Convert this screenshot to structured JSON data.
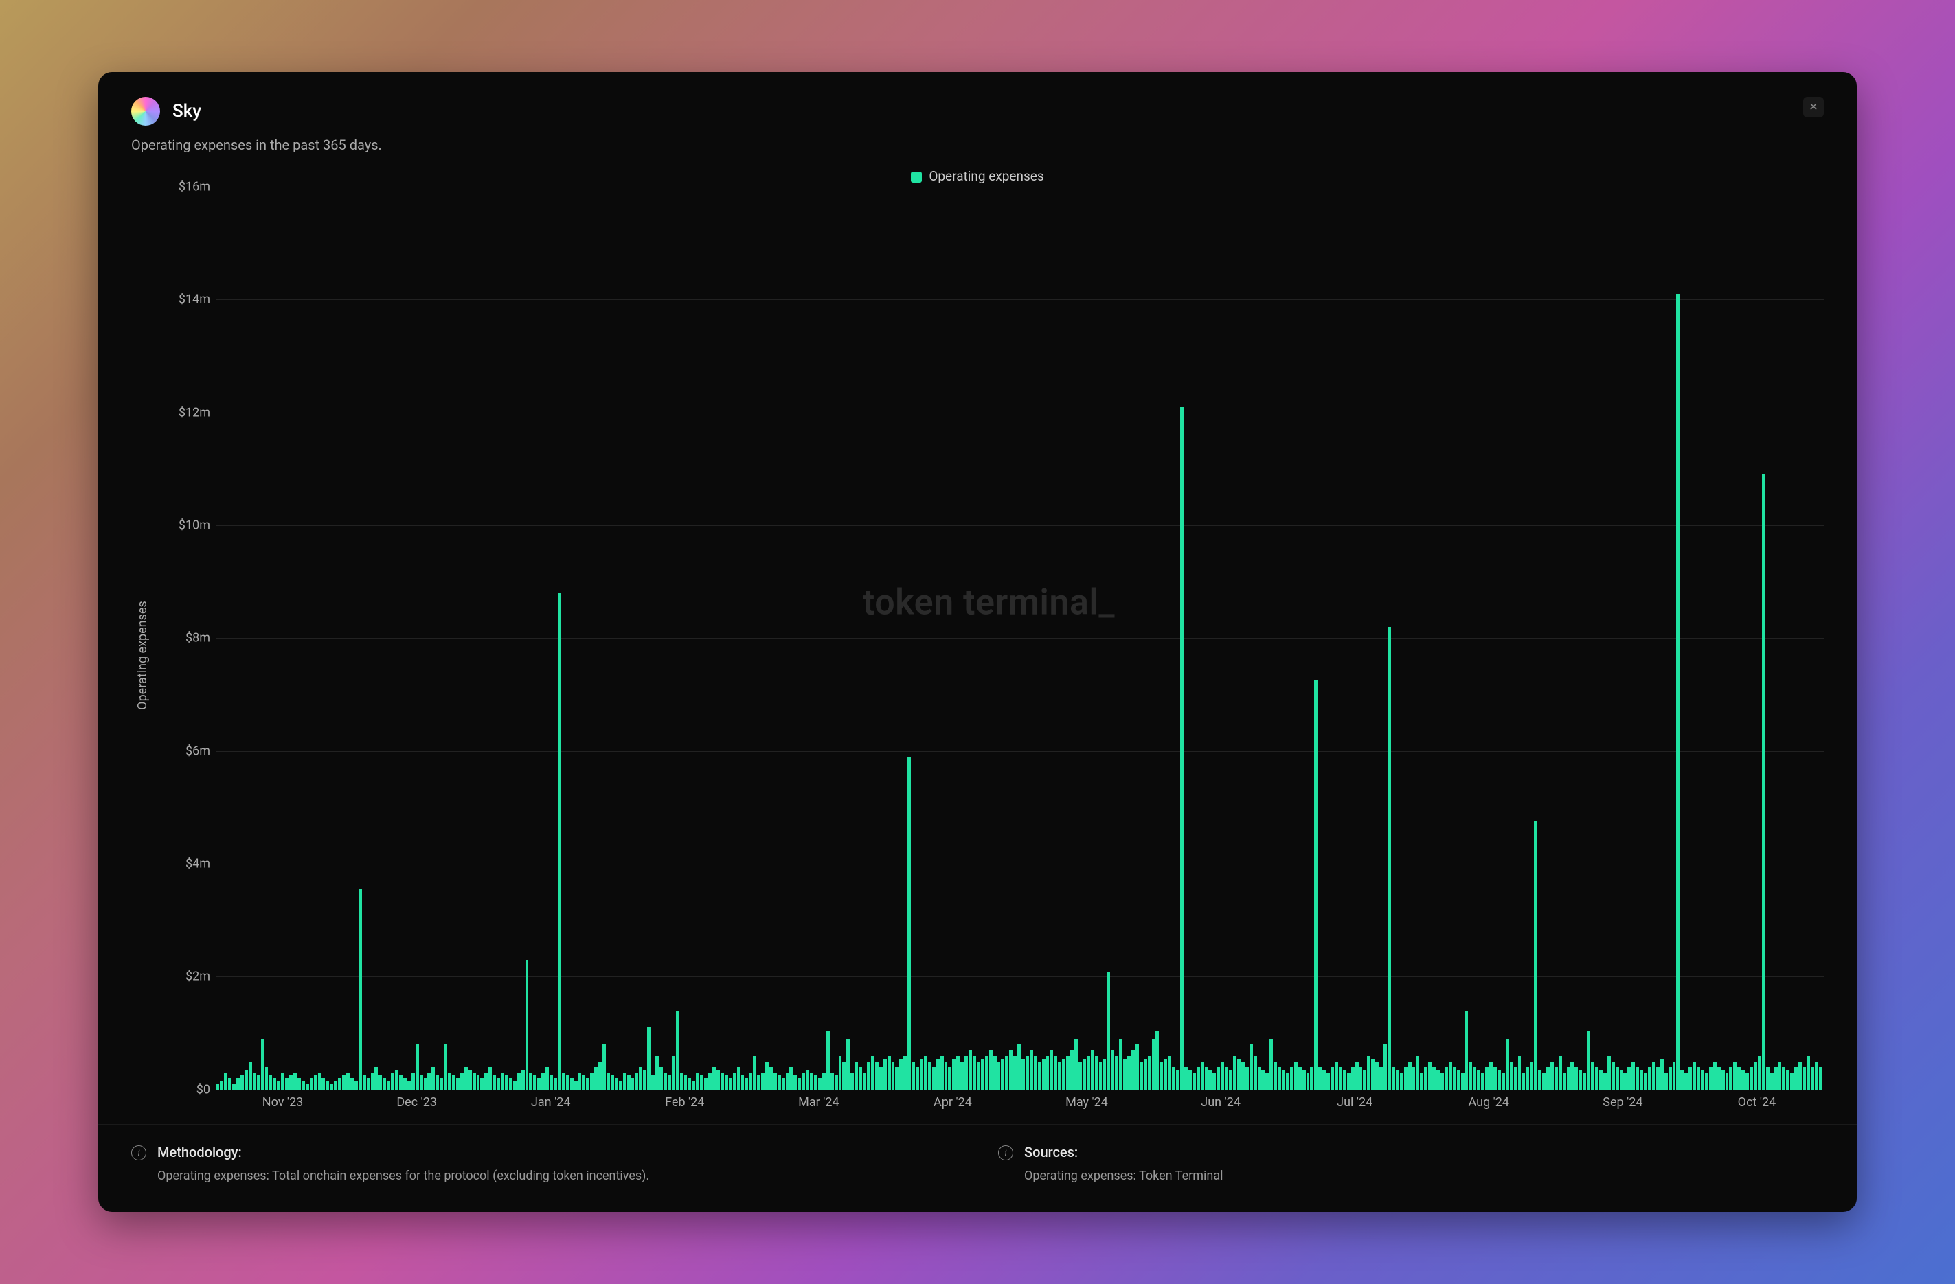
{
  "header": {
    "title": "Sky",
    "subtitle": "Operating expenses in the past 365 days."
  },
  "legend": {
    "label": "Operating expenses"
  },
  "watermark": "token terminal_",
  "footer": {
    "methodology_heading": "Methodology:",
    "methodology_text": "Operating expenses: Total onchain expenses for the protocol (excluding token incentives).",
    "sources_heading": "Sources:",
    "sources_text": "Operating expenses: Token Terminal"
  },
  "chart_data": {
    "type": "bar",
    "title": "Operating expenses in the past 365 days.",
    "ylabel": "Operating expenses",
    "xlabel": "",
    "ylim": [
      0,
      16000000
    ],
    "y_ticks": [
      "$0",
      "$2m",
      "$4m",
      "$6m",
      "$8m",
      "$10m",
      "$12m",
      "$14m",
      "$16m"
    ],
    "x_ticks": [
      "Nov '23",
      "Dec '23",
      "Jan '24",
      "Feb '24",
      "Mar '24",
      "Apr '24",
      "May '24",
      "Jun '24",
      "Jul '24",
      "Aug '24",
      "Sep '24",
      "Oct '24"
    ],
    "series_name": "Operating expenses",
    "series_color": "#20e3a2",
    "values": [
      0.1,
      0.15,
      0.3,
      0.2,
      0.1,
      0.2,
      0.25,
      0.35,
      0.5,
      0.3,
      0.25,
      0.9,
      0.4,
      0.25,
      0.2,
      0.15,
      0.3,
      0.2,
      0.25,
      0.3,
      0.2,
      0.15,
      0.1,
      0.2,
      0.25,
      0.3,
      0.2,
      0.15,
      0.1,
      0.15,
      0.2,
      0.25,
      0.3,
      0.2,
      0.15,
      3.55,
      0.25,
      0.2,
      0.3,
      0.4,
      0.25,
      0.2,
      0.15,
      0.3,
      0.35,
      0.25,
      0.2,
      0.15,
      0.3,
      0.8,
      0.25,
      0.2,
      0.3,
      0.4,
      0.25,
      0.2,
      0.8,
      0.3,
      0.25,
      0.2,
      0.3,
      0.4,
      0.35,
      0.3,
      0.25,
      0.2,
      0.3,
      0.4,
      0.25,
      0.2,
      0.3,
      0.25,
      0.2,
      0.15,
      0.3,
      0.35,
      2.3,
      0.3,
      0.25,
      0.2,
      0.3,
      0.4,
      0.25,
      0.2,
      8.8,
      0.3,
      0.25,
      0.2,
      0.15,
      0.3,
      0.25,
      0.2,
      0.3,
      0.4,
      0.5,
      0.8,
      0.3,
      0.25,
      0.2,
      0.15,
      0.3,
      0.25,
      0.2,
      0.3,
      0.4,
      0.35,
      1.1,
      0.25,
      0.6,
      0.4,
      0.3,
      0.25,
      0.6,
      1.4,
      0.3,
      0.25,
      0.2,
      0.15,
      0.3,
      0.25,
      0.2,
      0.3,
      0.4,
      0.35,
      0.3,
      0.25,
      0.2,
      0.3,
      0.4,
      0.25,
      0.2,
      0.3,
      0.6,
      0.25,
      0.3,
      0.5,
      0.4,
      0.3,
      0.25,
      0.2,
      0.3,
      0.4,
      0.25,
      0.2,
      0.3,
      0.35,
      0.3,
      0.25,
      0.2,
      0.3,
      1.05,
      0.3,
      0.25,
      0.6,
      0.5,
      0.9,
      0.3,
      0.5,
      0.4,
      0.3,
      0.5,
      0.6,
      0.5,
      0.4,
      0.55,
      0.6,
      0.5,
      0.4,
      0.55,
      0.6,
      5.9,
      0.5,
      0.4,
      0.55,
      0.6,
      0.5,
      0.4,
      0.55,
      0.6,
      0.5,
      0.4,
      0.55,
      0.6,
      0.5,
      0.6,
      0.7,
      0.6,
      0.5,
      0.55,
      0.6,
      0.7,
      0.6,
      0.5,
      0.55,
      0.6,
      0.7,
      0.6,
      0.8,
      0.55,
      0.6,
      0.7,
      0.6,
      0.5,
      0.55,
      0.6,
      0.7,
      0.6,
      0.5,
      0.55,
      0.6,
      0.7,
      0.9,
      0.5,
      0.55,
      0.6,
      0.7,
      0.6,
      0.5,
      0.55,
      2.08,
      0.7,
      0.6,
      0.9,
      0.55,
      0.6,
      0.7,
      0.8,
      0.5,
      0.55,
      0.6,
      0.9,
      1.05,
      0.5,
      0.55,
      0.6,
      0.4,
      0.35,
      12.1,
      0.4,
      0.35,
      0.3,
      0.4,
      0.5,
      0.4,
      0.35,
      0.3,
      0.4,
      0.5,
      0.4,
      0.35,
      0.6,
      0.55,
      0.5,
      0.4,
      0.8,
      0.6,
      0.4,
      0.35,
      0.3,
      0.9,
      0.5,
      0.4,
      0.35,
      0.3,
      0.4,
      0.5,
      0.4,
      0.35,
      0.3,
      0.4,
      7.25,
      0.4,
      0.35,
      0.3,
      0.4,
      0.5,
      0.4,
      0.35,
      0.3,
      0.4,
      0.5,
      0.4,
      0.35,
      0.6,
      0.55,
      0.5,
      0.4,
      0.8,
      8.2,
      0.4,
      0.35,
      0.3,
      0.4,
      0.5,
      0.4,
      0.6,
      0.3,
      0.4,
      0.5,
      0.4,
      0.35,
      0.3,
      0.4,
      0.5,
      0.4,
      0.35,
      0.3,
      1.4,
      0.5,
      0.4,
      0.35,
      0.3,
      0.4,
      0.5,
      0.4,
      0.35,
      0.3,
      0.9,
      0.5,
      0.4,
      0.6,
      0.3,
      0.4,
      0.5,
      4.75,
      0.35,
      0.3,
      0.4,
      0.5,
      0.4,
      0.6,
      0.3,
      0.4,
      0.5,
      0.4,
      0.35,
      0.3,
      1.05,
      0.5,
      0.4,
      0.35,
      0.3,
      0.6,
      0.5,
      0.4,
      0.35,
      0.3,
      0.4,
      0.5,
      0.4,
      0.35,
      0.3,
      0.4,
      0.5,
      0.4,
      0.55,
      0.3,
      0.4,
      0.5,
      14.1,
      0.35,
      0.3,
      0.4,
      0.5,
      0.4,
      0.35,
      0.3,
      0.4,
      0.5,
      0.4,
      0.35,
      0.3,
      0.4,
      0.5,
      0.4,
      0.35,
      0.3,
      0.4,
      0.5,
      0.6,
      10.9,
      0.4,
      0.3,
      0.4,
      0.5,
      0.4,
      0.35,
      0.3,
      0.4,
      0.5,
      0.4,
      0.6,
      0.4,
      0.5,
      0.4
    ],
    "values_unit": "millions_usd"
  }
}
